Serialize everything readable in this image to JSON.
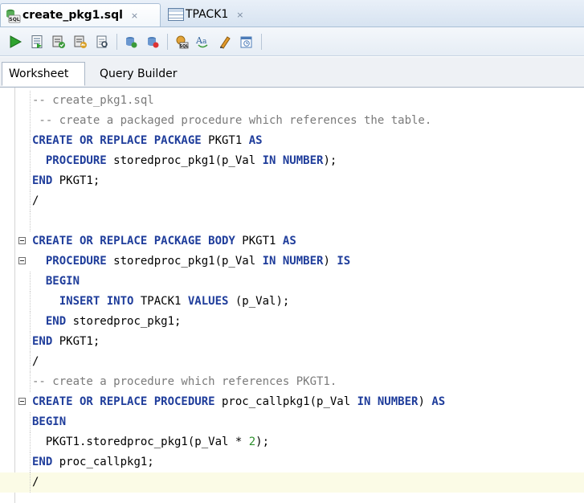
{
  "doc_tabs": [
    {
      "label": "create_pkg1.sql",
      "close": "×",
      "active": true,
      "icon": "sql-file-icon"
    },
    {
      "label": "TPACK1",
      "close": "×",
      "active": false,
      "icon": "table-icon"
    }
  ],
  "toolbar": {
    "buttons": [
      "run-statement-icon",
      "run-script-icon",
      "commit-icon",
      "rollback-icon",
      "autotrace-icon",
      "explain-plan-icon",
      "sql-tuning-icon",
      "unshared-sql-icon",
      "to-upper-case-icon",
      "clear-icon",
      "sql-history-icon"
    ]
  },
  "sub_tabs": [
    {
      "label": "Worksheet",
      "active": true
    },
    {
      "label": "Query Builder",
      "active": false
    }
  ],
  "colors": {
    "keyword": "#1f3d9b",
    "comment": "#7a7a7a",
    "number": "#2d8f2d",
    "current_line": "#fbfbe6"
  },
  "editor": {
    "lines": [
      {
        "fold": false,
        "current": false,
        "tokens": [
          {
            "t": "-- create_pkg1.sql",
            "c": "cm"
          }
        ]
      },
      {
        "fold": false,
        "current": false,
        "tokens": [
          {
            "t": " -- create a packaged procedure which references the table.",
            "c": "cm"
          }
        ]
      },
      {
        "fold": false,
        "current": false,
        "tokens": [
          {
            "t": "CREATE OR REPLACE PACKAGE",
            "c": "kw"
          },
          {
            "t": " PKGT1 ",
            "c": ""
          },
          {
            "t": "AS",
            "c": "kw"
          }
        ]
      },
      {
        "fold": false,
        "current": false,
        "tokens": [
          {
            "t": "  ",
            "c": ""
          },
          {
            "t": "PROCEDURE",
            "c": "kw"
          },
          {
            "t": " storedproc_pkg1(p_Val ",
            "c": ""
          },
          {
            "t": "IN NUMBER",
            "c": "kw"
          },
          {
            "t": ");",
            "c": ""
          }
        ]
      },
      {
        "fold": false,
        "current": false,
        "tokens": [
          {
            "t": "END",
            "c": "kw"
          },
          {
            "t": " PKGT1;",
            "c": ""
          }
        ]
      },
      {
        "fold": false,
        "current": false,
        "tokens": [
          {
            "t": "/",
            "c": ""
          }
        ]
      },
      {
        "fold": false,
        "current": false,
        "tokens": []
      },
      {
        "fold": true,
        "current": false,
        "tokens": [
          {
            "t": "CREATE OR REPLACE PACKAGE BODY",
            "c": "kw"
          },
          {
            "t": " PKGT1 ",
            "c": ""
          },
          {
            "t": "AS",
            "c": "kw"
          }
        ]
      },
      {
        "fold": true,
        "current": false,
        "tokens": [
          {
            "t": "  ",
            "c": ""
          },
          {
            "t": "PROCEDURE",
            "c": "kw"
          },
          {
            "t": " storedproc_pkg1(p_Val ",
            "c": ""
          },
          {
            "t": "IN NUMBER",
            "c": "kw"
          },
          {
            "t": ") ",
            "c": ""
          },
          {
            "t": "IS",
            "c": "kw"
          }
        ]
      },
      {
        "fold": false,
        "current": false,
        "tokens": [
          {
            "t": "  ",
            "c": ""
          },
          {
            "t": "BEGIN",
            "c": "kw"
          }
        ]
      },
      {
        "fold": false,
        "current": false,
        "tokens": [
          {
            "t": "    ",
            "c": ""
          },
          {
            "t": "INSERT INTO",
            "c": "kw"
          },
          {
            "t": " TPACK1 ",
            "c": ""
          },
          {
            "t": "VALUES",
            "c": "kw"
          },
          {
            "t": " (p_Val);",
            "c": ""
          }
        ]
      },
      {
        "fold": false,
        "current": false,
        "tokens": [
          {
            "t": "  ",
            "c": ""
          },
          {
            "t": "END",
            "c": "kw"
          },
          {
            "t": " storedproc_pkg1;",
            "c": ""
          }
        ]
      },
      {
        "fold": false,
        "current": false,
        "tokens": [
          {
            "t": "END",
            "c": "kw"
          },
          {
            "t": " PKGT1;",
            "c": ""
          }
        ]
      },
      {
        "fold": false,
        "current": false,
        "tokens": [
          {
            "t": "/",
            "c": ""
          }
        ]
      },
      {
        "fold": false,
        "current": false,
        "tokens": [
          {
            "t": "-- create a procedure which references PKGT1.",
            "c": "cm"
          }
        ]
      },
      {
        "fold": true,
        "current": false,
        "tokens": [
          {
            "t": "CREATE OR REPLACE PROCEDURE",
            "c": "kw"
          },
          {
            "t": " proc_callpkg1(p_Val ",
            "c": ""
          },
          {
            "t": "IN NUMBER",
            "c": "kw"
          },
          {
            "t": ") ",
            "c": ""
          },
          {
            "t": "AS",
            "c": "kw"
          }
        ]
      },
      {
        "fold": false,
        "current": false,
        "tokens": [
          {
            "t": "BEGIN",
            "c": "kw"
          }
        ]
      },
      {
        "fold": false,
        "current": false,
        "tokens": [
          {
            "t": "  PKGT1.storedproc_pkg1(p_Val * ",
            "c": ""
          },
          {
            "t": "2",
            "c": "num"
          },
          {
            "t": ");",
            "c": ""
          }
        ]
      },
      {
        "fold": false,
        "current": false,
        "tokens": [
          {
            "t": "END",
            "c": "kw"
          },
          {
            "t": " proc_callpkg1;",
            "c": ""
          }
        ]
      },
      {
        "fold": false,
        "current": true,
        "tokens": [
          {
            "t": "/",
            "c": ""
          }
        ]
      }
    ]
  }
}
